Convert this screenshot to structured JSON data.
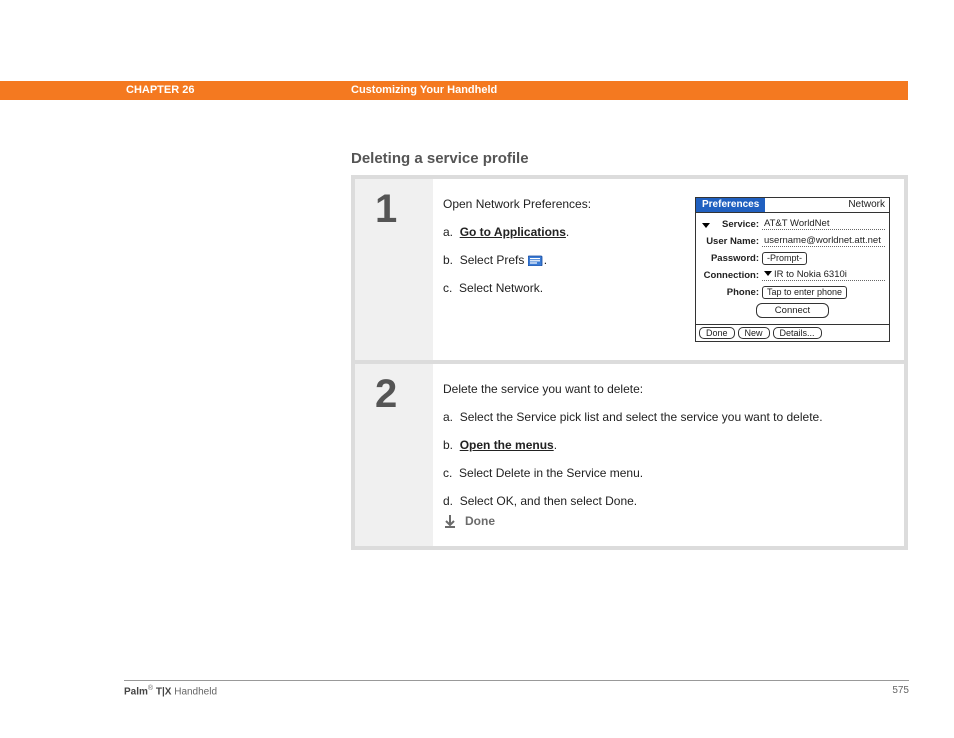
{
  "header": {
    "chapter": "CHAPTER 26",
    "title": "Customizing Your Handheld"
  },
  "section_heading": "Deleting a service profile",
  "steps": {
    "one": {
      "num": "1",
      "intro": "Open Network Preferences:",
      "a_prefix": "a.",
      "a_link": "Go to Applications",
      "a_suffix": ".",
      "b_prefix": "b.",
      "b_text": "Select Prefs ",
      "b_suffix": ".",
      "c_prefix": "c.",
      "c_text": "Select Network."
    },
    "two": {
      "num": "2",
      "intro": "Delete the service you want to delete:",
      "a_prefix": "a.",
      "a_text": "Select the Service pick list and select the service you want to delete.",
      "b_prefix": "b.",
      "b_link": "Open the menus",
      "b_suffix": ".",
      "c_prefix": "c.",
      "c_text": "Select Delete in the Service menu.",
      "d_prefix": "d.",
      "d_text": "Select OK, and then select Done.",
      "done": "Done"
    }
  },
  "palm": {
    "title_left": "Preferences",
    "title_right": "Network",
    "service_label": "Service:",
    "service_value": "AT&T WorldNet",
    "username_label": "User Name:",
    "username_value": "username@worldnet.att.net",
    "password_label": "Password:",
    "password_value": "-Prompt-",
    "connection_label": "Connection:",
    "connection_value": "IR to Nokia 6310i",
    "phone_label": "Phone:",
    "phone_value": "Tap to enter phone",
    "connect": "Connect",
    "footer_done": "Done",
    "footer_new": "New",
    "footer_details": "Details..."
  },
  "footer": {
    "product_bold": "Palm",
    "product_reg": "®",
    "product_model": " T|X",
    "product_suffix": " Handheld",
    "page": "575"
  }
}
